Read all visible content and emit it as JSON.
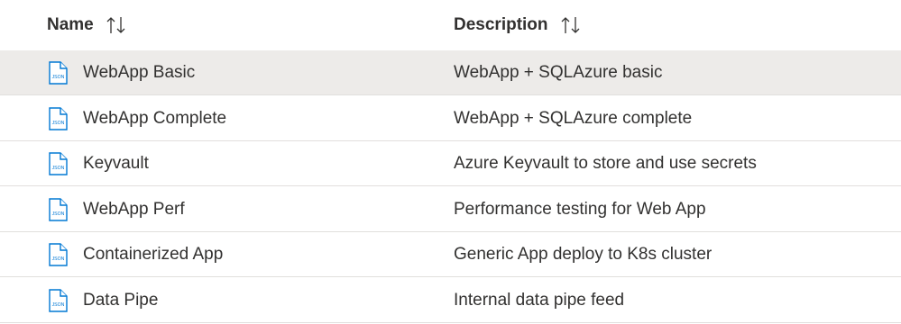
{
  "header": {
    "name_label": "Name",
    "description_label": "Description",
    "sort_icon": "sort-up-down-icon"
  },
  "rows": [
    {
      "name": "WebApp Basic",
      "description": "WebApp + SQLAzure basic",
      "icon": "json-file-icon",
      "icon_text": "JSON",
      "selected": true
    },
    {
      "name": "WebApp Complete",
      "description": "WebApp + SQLAzure complete",
      "icon": "json-file-icon",
      "icon_text": "JSON",
      "selected": false
    },
    {
      "name": "Keyvault",
      "description": "Azure Keyvault to store and use secrets",
      "icon": "json-file-icon",
      "icon_text": "JSON",
      "selected": false
    },
    {
      "name": "WebApp Perf",
      "description": "Performance testing for Web App",
      "icon": "json-file-icon",
      "icon_text": "JSON",
      "selected": false
    },
    {
      "name": "Containerized App",
      "description": "Generic App deploy to K8s cluster",
      "icon": "json-file-icon",
      "icon_text": "JSON",
      "selected": false
    },
    {
      "name": "Data Pipe",
      "description": "Internal data pipe feed",
      "icon": "json-file-icon",
      "icon_text": "JSON",
      "selected": false
    }
  ],
  "colors": {
    "selected_row": "#edebe9",
    "icon_blue": "#0078d4",
    "divider": "#e1dfdd"
  }
}
